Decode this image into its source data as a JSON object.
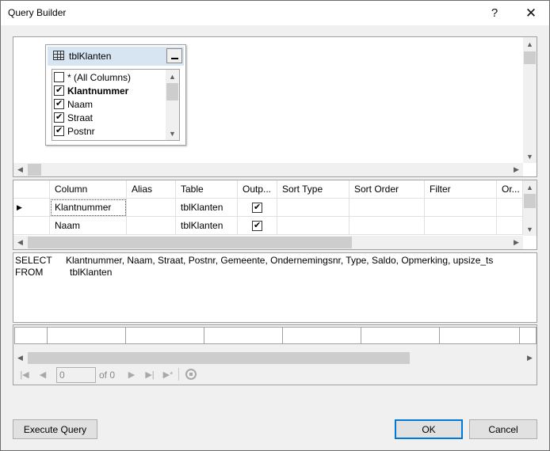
{
  "window": {
    "title": "Query Builder",
    "help_glyph": "?",
    "close_glyph": "✕"
  },
  "diagram": {
    "table_name": "tblKlanten",
    "columns": [
      {
        "label": "* (All Columns)",
        "checked": false,
        "bold": false
      },
      {
        "label": "Klantnummer",
        "checked": true,
        "bold": true
      },
      {
        "label": "Naam",
        "checked": true,
        "bold": false
      },
      {
        "label": "Straat",
        "checked": true,
        "bold": false
      },
      {
        "label": "Postnr",
        "checked": true,
        "bold": false
      }
    ]
  },
  "grid": {
    "headers": [
      "Column",
      "Alias",
      "Table",
      "Outp...",
      "Sort Type",
      "Sort Order",
      "Filter",
      "Or..."
    ],
    "rows": [
      {
        "column": "Klantnummer",
        "alias": "",
        "table": "tblKlanten",
        "output": true,
        "current": true
      },
      {
        "column": "Naam",
        "alias": "",
        "table": "tblKlanten",
        "output": true,
        "current": false
      }
    ]
  },
  "sql": {
    "select_kw": "SELECT",
    "select_cols": "Klantnummer, Naam, Straat, Postnr, Gemeente, Ondernemingsnr, Type, Saldo, Opmerking, upsize_ts",
    "from_kw": "FROM",
    "from_table": "tblKlanten"
  },
  "navigator": {
    "position_value": "0",
    "of_label": "of 0"
  },
  "buttons": {
    "execute": "Execute Query",
    "ok": "OK",
    "cancel": "Cancel"
  },
  "colors": {
    "accent": "#0078d7",
    "table_header": "#d7e4f2"
  }
}
